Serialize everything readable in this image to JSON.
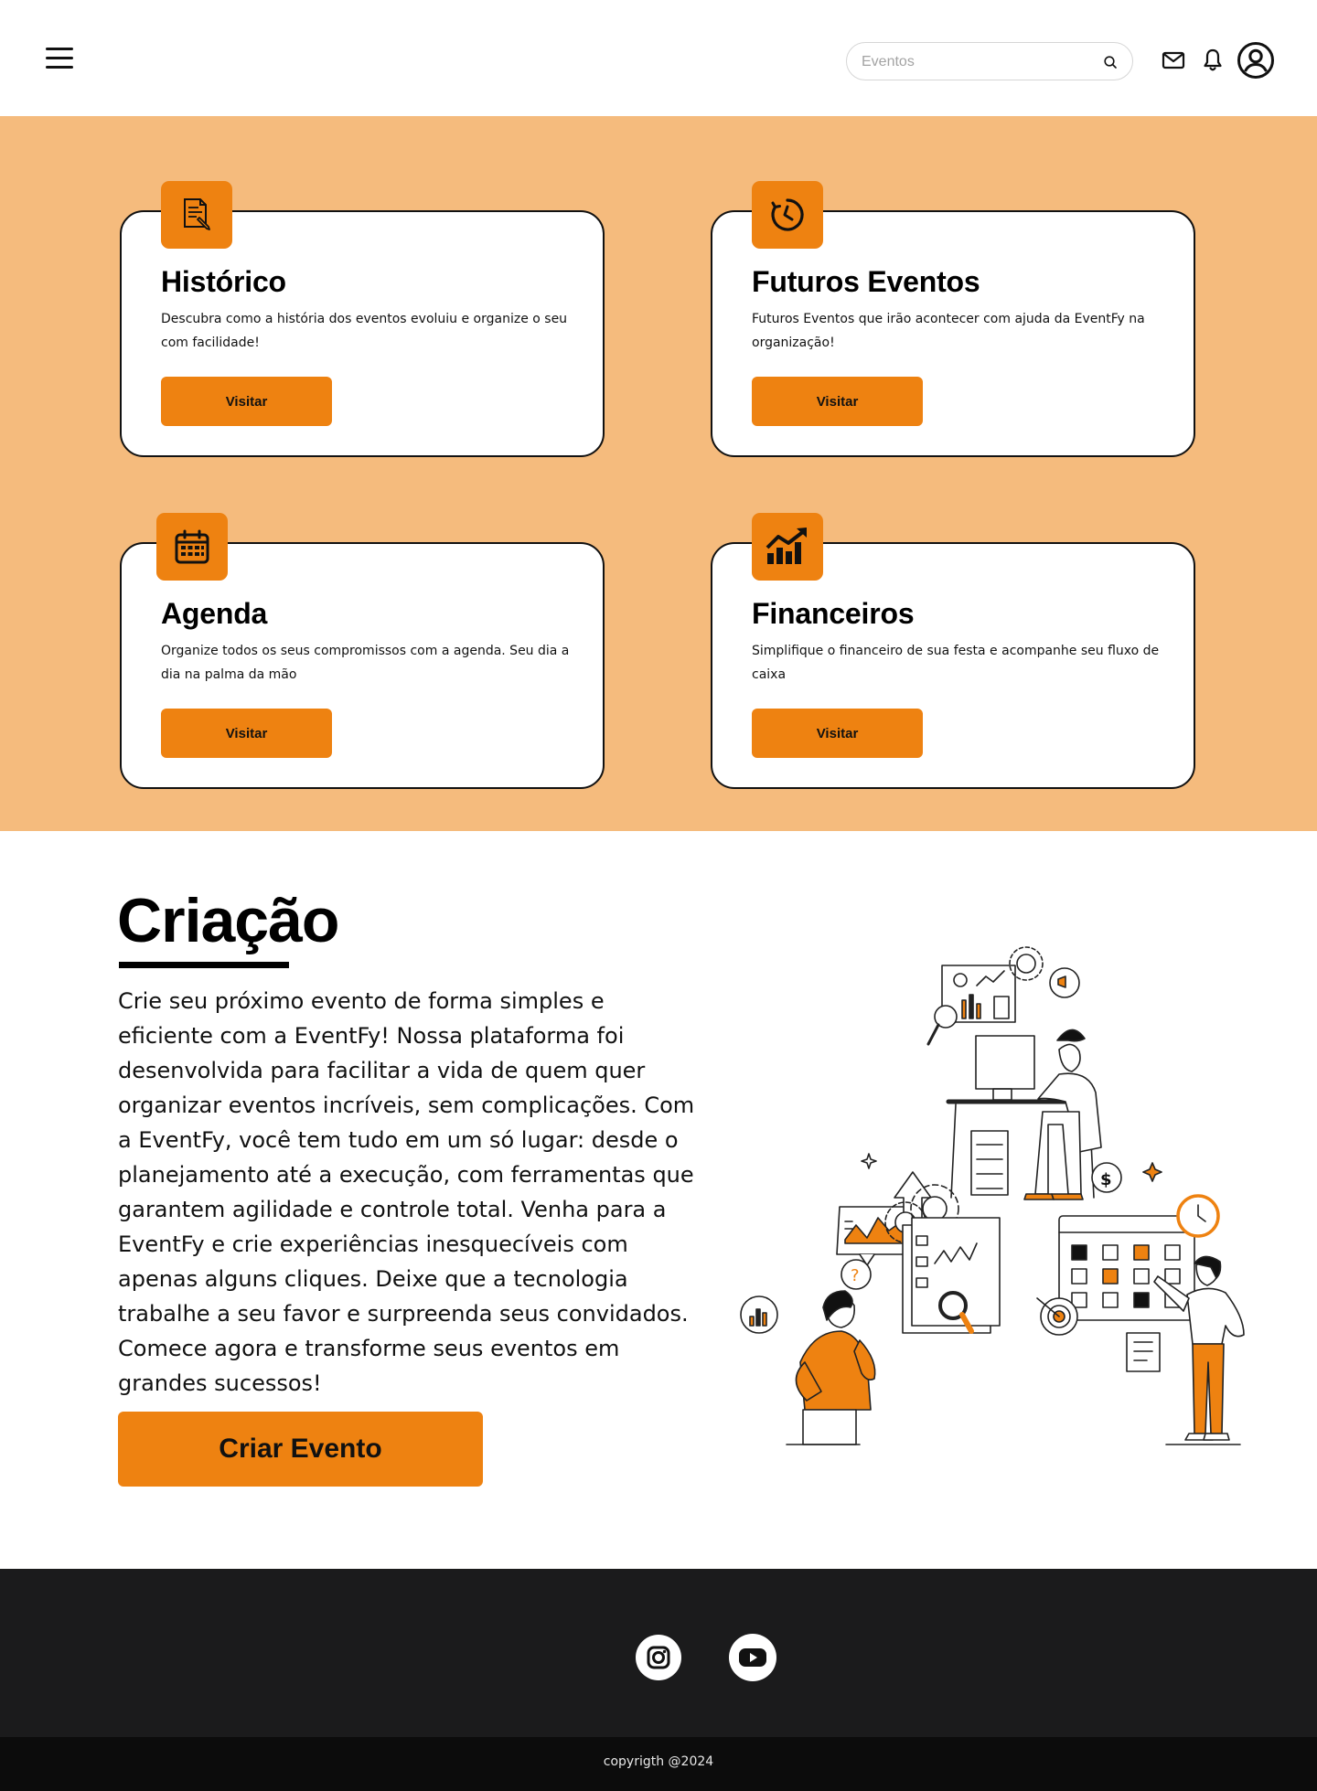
{
  "header": {
    "search": {
      "placeholder": "Eventos",
      "value": ""
    },
    "icons": [
      "menu-icon",
      "search-icon",
      "mail-icon",
      "bell-icon",
      "user-icon"
    ]
  },
  "cards": [
    {
      "title": "Histórico",
      "description": "Descubra como a história dos eventos evoluiu e organize o seu com facilidade!",
      "button": "Visitar",
      "icon": "document-edit-icon"
    },
    {
      "title": "Futuros Eventos",
      "description": "Futuros Eventos que irão acontecer com ajuda da EventFy na organização!",
      "button": "Visitar",
      "icon": "timer-icon"
    },
    {
      "title": "Agenda",
      "description": "Organize todos os seus compromissos com a agenda. Seu dia a dia na palma da mão",
      "button": "Visitar",
      "icon": "calendar-icon"
    },
    {
      "title": "Financeiros",
      "description": "Simplifique o financeiro de sua festa e acompanhe seu fluxo de caixa",
      "button": "Visitar",
      "icon": "chart-growth-icon"
    }
  ],
  "criacao": {
    "title": "Criação",
    "text": "Crie seu próximo evento de forma simples e eficiente com a EventFy! Nossa plataforma foi desenvolvida para facilitar a vida de quem quer organizar eventos incríveis, sem complicações. Com a EventFy, você tem tudo em um só lugar: desde o planejamento até a execução, com ferramentas que garantem agilidade e controle total. Venha para a EventFy e crie experiências inesquecíveis com apenas alguns cliques. Deixe que a tecnologia trabalhe a seu favor e surpreenda seus convidados. Comece agora e transforme seus eventos em grandes sucessos!",
    "button": "Criar Evento"
  },
  "footer": {
    "social": [
      "instagram-icon",
      "youtube-icon"
    ],
    "copyright": "copyrigth @2024"
  },
  "colors": {
    "accent": "#ee8211",
    "section_bg": "#f5bb7d",
    "footer_bg": "#1b1b1c",
    "copyright_bg": "#0c0c0c"
  }
}
